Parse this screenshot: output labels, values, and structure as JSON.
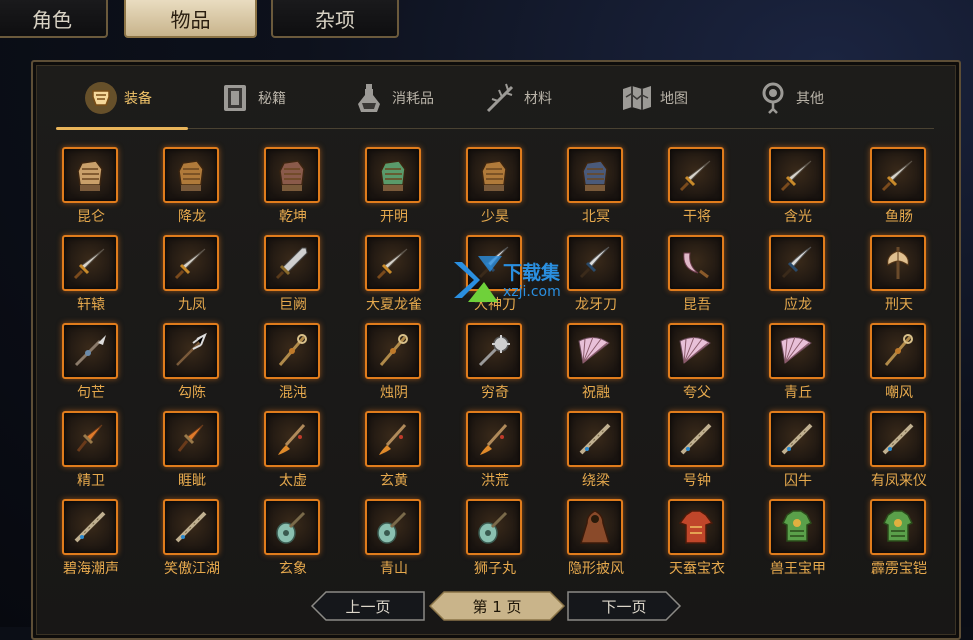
{
  "top_tabs": [
    {
      "label": "角色",
      "active": false
    },
    {
      "label": "物品",
      "active": true
    },
    {
      "label": "杂项",
      "active": false
    }
  ],
  "categories": [
    {
      "label": "装备",
      "icon": "armor-icon",
      "active": true
    },
    {
      "label": "秘籍",
      "icon": "book-icon",
      "active": false
    },
    {
      "label": "消耗品",
      "icon": "potion-icon",
      "active": false
    },
    {
      "label": "材料",
      "icon": "herb-icon",
      "active": false
    },
    {
      "label": "地图",
      "icon": "map-icon",
      "active": false
    },
    {
      "label": "其他",
      "icon": "pendant-icon",
      "active": false
    }
  ],
  "items": [
    {
      "name": "昆仑",
      "icon": "gauntlet-icon"
    },
    {
      "name": "降龙",
      "icon": "gauntlet-icon"
    },
    {
      "name": "乾坤",
      "icon": "gauntlet-icon"
    },
    {
      "name": "开明",
      "icon": "gauntlet-icon"
    },
    {
      "name": "少昊",
      "icon": "gauntlet-icon"
    },
    {
      "name": "北冥",
      "icon": "gauntlet-icon"
    },
    {
      "name": "干将",
      "icon": "sword-icon"
    },
    {
      "name": "含光",
      "icon": "sword-icon"
    },
    {
      "name": "鱼肠",
      "icon": "sword-icon"
    },
    {
      "name": "轩辕",
      "icon": "sword-icon"
    },
    {
      "name": "九凤",
      "icon": "sword-icon"
    },
    {
      "name": "巨阙",
      "icon": "broadsword-icon"
    },
    {
      "name": "大夏龙雀",
      "icon": "sword-icon"
    },
    {
      "name": "大神刀",
      "icon": "blade-icon"
    },
    {
      "name": "龙牙刀",
      "icon": "blade-icon"
    },
    {
      "name": "昆吾",
      "icon": "scimitar-icon"
    },
    {
      "name": "应龙",
      "icon": "blade-icon"
    },
    {
      "name": "刑天",
      "icon": "axe-icon"
    },
    {
      "name": "句芒",
      "icon": "spear-icon"
    },
    {
      "name": "勾陈",
      "icon": "halberd-icon"
    },
    {
      "name": "混沌",
      "icon": "staff-icon"
    },
    {
      "name": "烛阴",
      "icon": "staff-icon"
    },
    {
      "name": "穷奇",
      "icon": "mace-icon"
    },
    {
      "name": "祝融",
      "icon": "fan-icon"
    },
    {
      "name": "夸父",
      "icon": "fan-icon"
    },
    {
      "name": "青丘",
      "icon": "fan-icon"
    },
    {
      "name": "嘲风",
      "icon": "staff-icon"
    },
    {
      "name": "精卫",
      "icon": "dagger-icon"
    },
    {
      "name": "睚眦",
      "icon": "dagger-icon"
    },
    {
      "name": "太虚",
      "icon": "brush-icon"
    },
    {
      "name": "玄黄",
      "icon": "brush-icon"
    },
    {
      "name": "洪荒",
      "icon": "brush-icon"
    },
    {
      "name": "绕梁",
      "icon": "flute-icon"
    },
    {
      "name": "号钟",
      "icon": "flute-icon"
    },
    {
      "name": "囚牛",
      "icon": "flute-icon"
    },
    {
      "name": "有凤来仪",
      "icon": "flute-icon"
    },
    {
      "name": "碧海潮声",
      "icon": "flute-icon"
    },
    {
      "name": "笑傲江湖",
      "icon": "flute-icon"
    },
    {
      "name": "玄象",
      "icon": "pipa-icon"
    },
    {
      "name": "青山",
      "icon": "pipa-icon"
    },
    {
      "name": "狮子丸",
      "icon": "pipa-icon"
    },
    {
      "name": "隐形披风",
      "icon": "cloak-icon"
    },
    {
      "name": "天蚕宝衣",
      "icon": "robe-icon"
    },
    {
      "name": "兽王宝甲",
      "icon": "armor-vest-icon"
    },
    {
      "name": "霹雳宝铠",
      "icon": "armor-vest-icon"
    }
  ],
  "pager": {
    "prev": "上一页",
    "current": "第 1 页",
    "next": "下一页"
  },
  "watermark": {
    "text": "下载集",
    "url": "xzji.com"
  },
  "colors": {
    "accent": "#e8b45a",
    "slot_border": "#e07c1c",
    "item_text": "#e6a94d"
  }
}
